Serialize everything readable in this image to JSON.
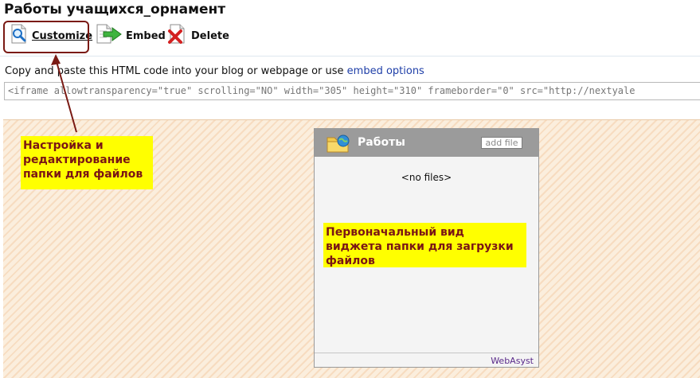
{
  "page": {
    "title": "Работы учащихся_орнамент"
  },
  "toolbar": {
    "customize_label": "Customize",
    "embed_label": "Embed",
    "delete_label": "Delete"
  },
  "embed": {
    "intro_text": "Copy and paste this HTML code into your blog or webpage or use",
    "link_text": "embed options",
    "code": "<iframe allowtransparency=\"true\" scrolling=\"NO\" width=\"305\" height=\"310\" frameborder=\"0\" src=\"http://nextyale"
  },
  "widget": {
    "title": "Работы",
    "add_button": "add file",
    "empty_text": "<no files>",
    "footer_link": "WebAsyst"
  },
  "annotations": {
    "customize_note": "Настройка и редактирование папки для файлов",
    "widget_note": "Первоначальный вид виджета папки для загрузки файлов"
  },
  "colors": {
    "note_background": "#ffff00",
    "note_text": "#7a1515",
    "highlight_border": "#7a1a14",
    "widget_header": "#9b9b9b",
    "link": "#1f3fa8"
  },
  "icons": {
    "customize": "magnifier-document-icon",
    "embed": "green-arrow-document-icon",
    "delete": "red-x-document-icon",
    "widget_folder": "folder-globe-icon"
  }
}
